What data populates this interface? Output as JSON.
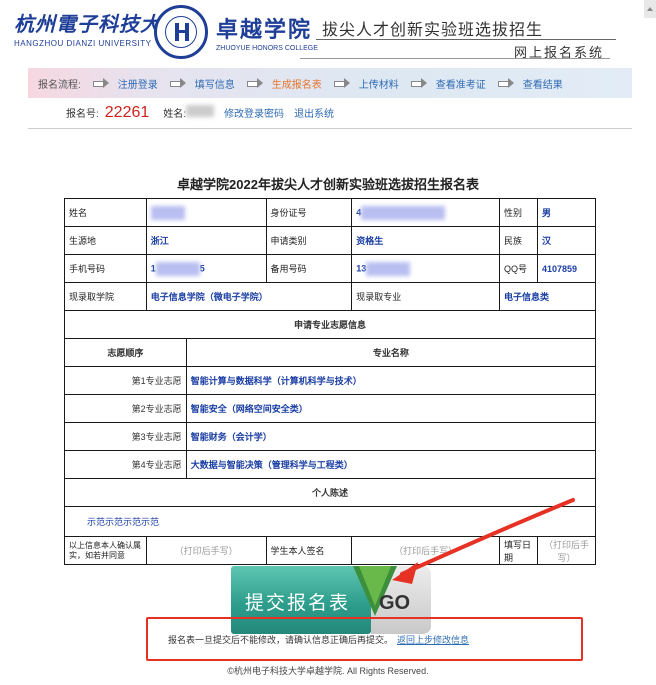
{
  "header": {
    "university_cn": "杭州電子科技大學",
    "university_en": "HANGZHOU DIANZI UNIVERSITY",
    "college_cn": "卓越学院",
    "college_en": "ZHUOYUE HONORS COLLEGE",
    "program_title": "拔尖人才创新实验班选拔招生",
    "system_name": "网上报名系统"
  },
  "steps": {
    "lead": "报名流程:",
    "items": [
      {
        "label": "注册登录",
        "state": "link"
      },
      {
        "label": "填写信息",
        "state": "link"
      },
      {
        "label": "生成报名表",
        "state": "active"
      },
      {
        "label": "上传材料",
        "state": "link"
      },
      {
        "label": "查看准考证",
        "state": "link"
      },
      {
        "label": "查看结果",
        "state": "link"
      }
    ]
  },
  "reg": {
    "number_label": "报名号:",
    "number": "22261",
    "name_label": "姓名:",
    "change_password": "修改登录密码",
    "logout": "退出系统"
  },
  "form": {
    "title": "卓越学院2022年拔尖人才创新实验班选拔招生报名表",
    "name_label": "姓名",
    "id_label": "身份证号",
    "id_value_prefix": "4",
    "gender_label": "性别",
    "gender_value": "男",
    "origin_label": "生源地",
    "origin_value": "浙江",
    "category_label": "申请类别",
    "category_value": "资格生",
    "ethnic_label": "民族",
    "ethnic_value": "汉",
    "phone_label": "手机号码",
    "phone_prefix": "1",
    "phone_suffix": "5",
    "backup_phone_label": "备用号码",
    "backup_phone_prefix": "13",
    "qq_label": "QQ号",
    "qq_value": "4107859",
    "college_label": "现录取学院",
    "college_value": "电子信息学院（微电子学院）",
    "major_label": "现录取专业",
    "major_value": "电子信息类",
    "choices_title": "申请专业志愿信息",
    "order_header": "志愿顺序",
    "major_header": "专业名称",
    "choices": [
      {
        "order": "第1专业志愿",
        "major": "智能计算与数据科学（计算机科学与技术）"
      },
      {
        "order": "第2专业志愿",
        "major": "智能安全（网络空间安全类）"
      },
      {
        "order": "第3专业志愿",
        "major": "智能财务（会计学）"
      },
      {
        "order": "第4专业志愿",
        "major": "大数据与智能决策（管理科学与工程类）"
      }
    ],
    "statement_title": "个人陈述",
    "statement_text": "示范示范示范示范",
    "confirm_label": "以上信息本人确认属实，如若并同意",
    "print_hint": "（打印后手写）",
    "signature_label": "学生本人签名",
    "date_label": "填写日期"
  },
  "submit": {
    "label": "提交报名表",
    "go": "GO"
  },
  "notice": {
    "text": "报名表一旦提交后不能修改，请确认信息正确后再提交。",
    "link": "返回上步修改信息"
  },
  "footer": {
    "copyright": "©杭州电子科技大学卓越学院. All Rights Reserved."
  },
  "colors": {
    "brand_blue": "#1f3e97",
    "link_blue": "#2f6bb3",
    "active_orange": "#e8742b",
    "reg_red": "#d0231c",
    "annotation_red": "#e53225",
    "button_green": "#2e9e8c"
  }
}
